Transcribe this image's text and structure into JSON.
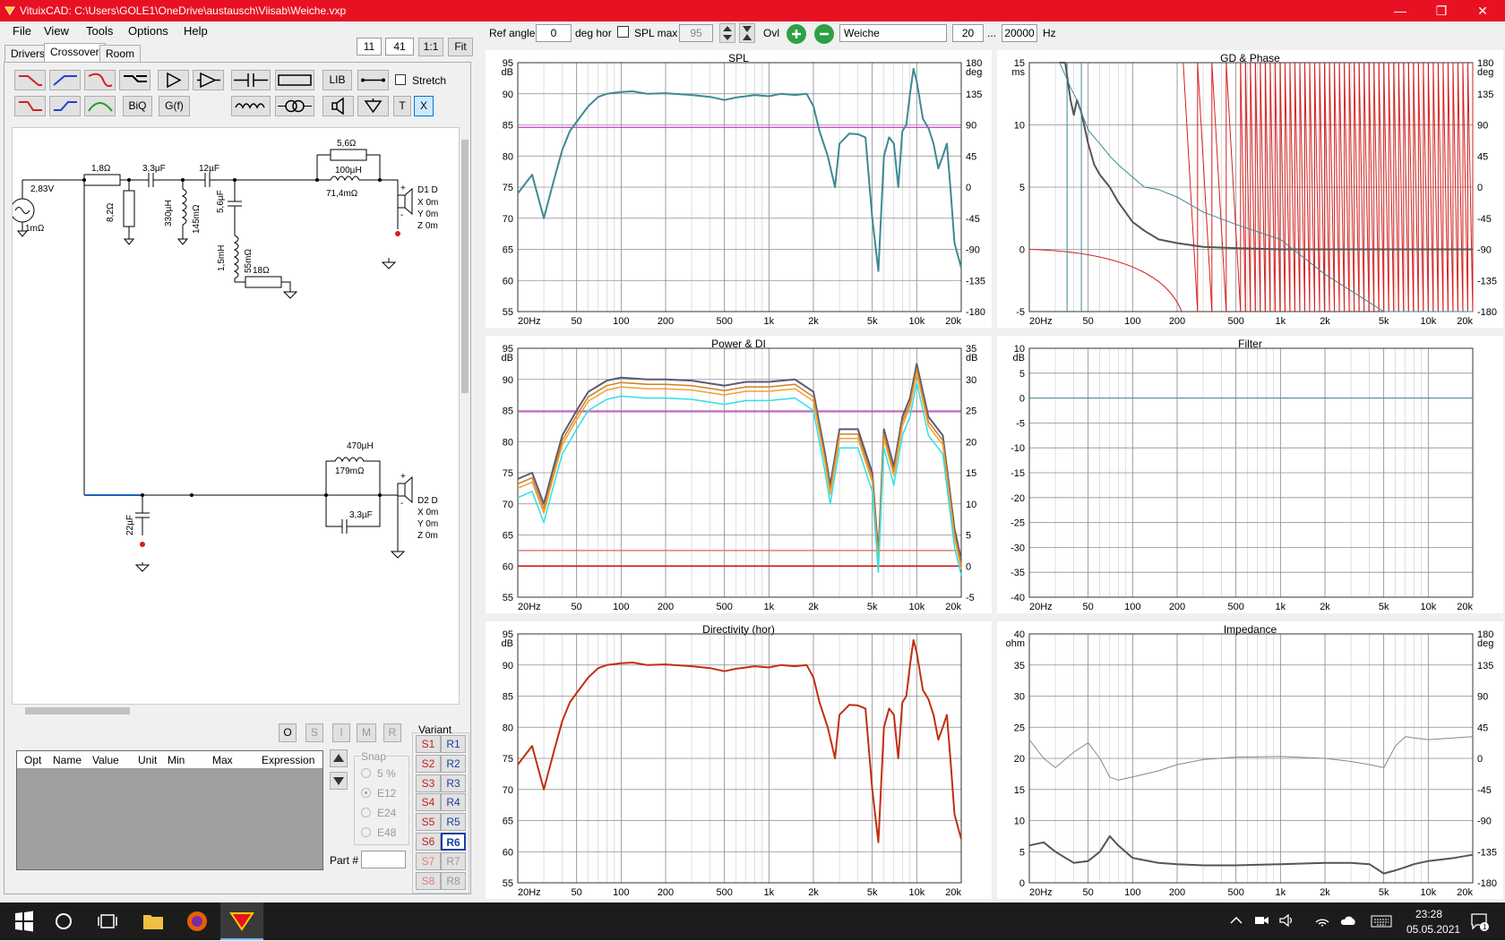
{
  "window": {
    "title": "VituixCAD: C:\\Users\\GOLE1\\OneDrive\\austausch\\Viisab\\Weiche.vxp",
    "minimize": "—",
    "maximize": "❐",
    "close": "✕"
  },
  "menu": [
    "File",
    "View",
    "Tools",
    "Options",
    "Help"
  ],
  "zoom": {
    "v1": "11",
    "v2": "41",
    "btn_11": "1:1",
    "btn_fit": "Fit"
  },
  "tabs": [
    "Drivers",
    "Crossover",
    "Room"
  ],
  "tools": {
    "lib": "LIB",
    "biq": "BiQ",
    "gf": "G(f)",
    "stretch": "Stretch",
    "t": "T",
    "x": "X"
  },
  "top": {
    "ref_angle_label": "Ref angle",
    "ref_angle": "0",
    "deg_hor": "deg hor",
    "spl_max_label": "SPL max",
    "spl_max": "95",
    "ovl_label": "Ovl",
    "name": "Weiche",
    "fmin": "20",
    "dots": "...",
    "fmax": "20000",
    "hz": "Hz"
  },
  "schematic": {
    "source": "2,83V",
    "source_r": "1mΩ",
    "r1": "1,8Ω",
    "r2": "8,2Ω",
    "c1": "3,3µF",
    "l1": "330µH",
    "l1r": "145mΩ",
    "c2": "12µF",
    "c3": "5,6µF",
    "l2": "1,5mH",
    "l2r": "55mΩ",
    "r3": "18Ω",
    "r4": "5,6Ω",
    "l3": "100µH",
    "l3r": "71,4mΩ",
    "d1": "D1 D",
    "d1x": "X 0m",
    "d1y": "Y 0m",
    "d1z": "Z 0m",
    "l4": "470µH",
    "l4r": "179mΩ",
    "c4": "3,3µF",
    "c5": "22µF",
    "d2": "D2 D",
    "d2x": "X 0m",
    "d2y": "Y 0m",
    "d2z": "Z 0m",
    "plus": "+",
    "minus": "-"
  },
  "osim": [
    "O",
    "S",
    "I",
    "M",
    "R"
  ],
  "table": {
    "headers": [
      "Opt",
      "Name",
      "Value",
      "Unit",
      "Min",
      "Max",
      "Expression"
    ]
  },
  "snap": {
    "label": "Snap",
    "options": [
      "5 %",
      "E12",
      "E24",
      "E48"
    ],
    "part_label": "Part #"
  },
  "variant": {
    "label": "Variant",
    "s": [
      "S1",
      "S2",
      "S3",
      "S4",
      "S5",
      "S6",
      "S7",
      "S8"
    ],
    "r": [
      "R1",
      "R2",
      "R3",
      "R4",
      "R5",
      "R6",
      "R7",
      "R8"
    ]
  },
  "colors": {
    "teal": "#3d8a94",
    "red": "#d42020",
    "magenta": "#cc33cc",
    "dir": "#c03010",
    "grid": "#c8c8c8",
    "gridMajor": "#8c8c8c"
  },
  "freq_ticks": [
    "20Hz",
    "50",
    "100",
    "200",
    "500",
    "1k",
    "2k",
    "5k",
    "10k",
    "20k"
  ],
  "chart_data": [
    {
      "type": "line",
      "title": "SPL",
      "ylabel": "dB",
      "y2label": "deg",
      "ylim": [
        55,
        95
      ],
      "y2lim": [
        -180,
        180
      ],
      "yticks": [
        "95",
        "90",
        "85",
        "80",
        "75",
        "70",
        "65",
        "60",
        "55"
      ],
      "y2ticks": [
        "180",
        "135",
        "90",
        "45",
        "0",
        "-45",
        "-90",
        "-135",
        "-180"
      ],
      "x": [
        20,
        25,
        30,
        35,
        40,
        45,
        50,
        60,
        70,
        80,
        100,
        120,
        150,
        200,
        300,
        400,
        500,
        600,
        700,
        800,
        1000,
        1200,
        1500,
        1800,
        2000,
        2200,
        2500,
        2800,
        3000,
        3500,
        4000,
        4500,
        5000,
        5500,
        6000,
        6500,
        7000,
        7500,
        8000,
        8500,
        9000,
        9500,
        10000,
        11000,
        12000,
        13000,
        14000,
        15000,
        16000,
        17000,
        18000,
        20000
      ],
      "series": [
        {
          "values": [
            74,
            77,
            70,
            76,
            81,
            84,
            85.5,
            88,
            89.5,
            90,
            90.3,
            90.4,
            90,
            90.1,
            89.8,
            89.5,
            89,
            89.4,
            89.6,
            89.8,
            89.6,
            90,
            89.8,
            90,
            88,
            84,
            80,
            75,
            82,
            83.6,
            83.5,
            83,
            70,
            61.5,
            80,
            83,
            82,
            75,
            84,
            85,
            90,
            94,
            92,
            86,
            84.5,
            82,
            78,
            80,
            82,
            74,
            66,
            62
          ]
        }
      ],
      "hline": 84.6
    },
    {
      "type": "line",
      "title": "GD & Phase",
      "ylabel": "ms",
      "y2label": "deg",
      "ylim": [
        -5,
        15
      ],
      "y2lim": [
        -180,
        180
      ],
      "yticks": [
        "15",
        "10",
        "5",
        "0",
        "-5"
      ],
      "y2ticks": [
        "180",
        "135",
        "90",
        "45",
        "0",
        "-45",
        "-90",
        "-135",
        "-180"
      ],
      "x": [
        32,
        35,
        38,
        40,
        42,
        45,
        50,
        55,
        60,
        70,
        80,
        100,
        120,
        150,
        200,
        300,
        500,
        1000,
        2000,
        5000,
        10000,
        20000
      ],
      "series": [
        {
          "values": [
            15,
            15,
            12,
            10.8,
            12,
            11,
            8.5,
            6.8,
            6,
            5,
            3.8,
            2.2,
            1.5,
            0.8,
            0.5,
            0.2,
            0.1,
            0,
            0,
            0,
            0,
            0
          ]
        },
        {
          "values": [
            15,
            14,
            13,
            12.5,
            12,
            11,
            9.6,
            9,
            8.5,
            7.5,
            6.8,
            5.8,
            5,
            4.8,
            4.2,
            3,
            2,
            0.8,
            -2,
            -5,
            -5,
            -5
          ]
        }
      ]
    },
    {
      "type": "line",
      "title": "Power & DI",
      "ylabel": "dB",
      "y2label": "dB",
      "ylim": [
        55,
        95
      ],
      "y2lim": [
        -5,
        35
      ],
      "yticks": [
        "95",
        "90",
        "85",
        "80",
        "75",
        "70",
        "65",
        "60",
        "55"
      ],
      "y2ticks": [
        "35",
        "30",
        "25",
        "20",
        "15",
        "10",
        "5",
        "0",
        "-5"
      ],
      "x": [
        20,
        25,
        30,
        35,
        40,
        50,
        60,
        80,
        100,
        150,
        200,
        300,
        500,
        700,
        1000,
        1500,
        2000,
        2400,
        2600,
        3000,
        4000,
        5000,
        5500,
        6000,
        7000,
        8000,
        9000,
        10000,
        12000,
        15000,
        18000,
        20000
      ],
      "series": [
        {
          "values": [
            74,
            75,
            70,
            76,
            81,
            85,
            88,
            89.8,
            90.3,
            90,
            90,
            89.8,
            89,
            89.6,
            89.6,
            90,
            88,
            78,
            73,
            82,
            82,
            75,
            62,
            82,
            76,
            84,
            87,
            92.5,
            84,
            81,
            66,
            61
          ]
        },
        {
          "values": [
            73.2,
            74.2,
            69.2,
            75.2,
            80.2,
            84.2,
            87.2,
            89,
            89.5,
            89.2,
            89.2,
            89,
            88.2,
            88.8,
            88.8,
            89.2,
            87.2,
            77.2,
            72.2,
            81.2,
            81.2,
            74.2,
            61.2,
            81.2,
            75.2,
            83.2,
            86.2,
            91.7,
            83.2,
            80.2,
            65.2,
            60.2
          ]
        },
        {
          "values": [
            72.5,
            73.5,
            68.5,
            74.5,
            79.5,
            83.5,
            86.5,
            88.3,
            88.8,
            88.5,
            88.5,
            88.3,
            87.5,
            88.1,
            88.1,
            88.5,
            86.5,
            76.5,
            71.5,
            80.5,
            80.5,
            73.5,
            60.5,
            80.5,
            74.5,
            82.5,
            85.5,
            91,
            82.5,
            79.5,
            64.5,
            59.5
          ]
        },
        {
          "values": [
            71,
            72,
            67,
            73,
            78,
            82,
            85,
            86.8,
            87.3,
            87,
            87,
            86.8,
            86,
            86.6,
            86.6,
            87,
            85,
            75,
            70,
            79,
            79,
            72,
            59,
            79,
            73,
            81,
            84,
            89.5,
            81,
            78,
            63,
            58.5
          ]
        }
      ],
      "hlines": [
        84.8,
        62.5,
        60
      ]
    },
    {
      "type": "line",
      "title": "Filter",
      "ylabel": "dB",
      "ylim": [
        -40,
        10
      ],
      "yticks": [
        "10",
        "5",
        "0",
        "-5",
        "-10",
        "-15",
        "-20",
        "-25",
        "-30",
        "-35",
        "-40"
      ],
      "x": [
        20,
        20000
      ],
      "series": [
        {
          "values": [
            0,
            0
          ]
        }
      ]
    },
    {
      "type": "line",
      "title": "Directivity (hor)",
      "ylabel": "dB",
      "ylim": [
        55,
        95
      ],
      "yticks": [
        "95",
        "90",
        "85",
        "80",
        "75",
        "70",
        "65",
        "60",
        "55"
      ],
      "x": [
        20,
        25,
        30,
        35,
        40,
        45,
        50,
        60,
        70,
        80,
        100,
        120,
        150,
        200,
        300,
        400,
        500,
        600,
        700,
        800,
        1000,
        1200,
        1500,
        1800,
        2000,
        2200,
        2500,
        2800,
        3000,
        3500,
        4000,
        4500,
        5000,
        5500,
        6000,
        6500,
        7000,
        7500,
        8000,
        8500,
        9000,
        9500,
        10000,
        11000,
        12000,
        13000,
        14000,
        15000,
        16000,
        17000,
        18000,
        20000
      ],
      "series": [
        {
          "values": [
            74,
            77,
            70,
            76,
            81,
            84,
            85.5,
            88,
            89.5,
            90,
            90.3,
            90.4,
            90,
            90.1,
            89.8,
            89.5,
            89,
            89.4,
            89.6,
            89.8,
            89.6,
            90,
            89.8,
            90,
            88,
            84,
            80,
            75,
            82,
            83.6,
            83.5,
            83,
            70,
            61.5,
            80,
            83,
            82,
            75,
            84,
            85,
            90,
            94,
            92,
            86,
            84.5,
            82,
            78,
            80,
            82,
            74,
            66,
            62
          ]
        }
      ]
    },
    {
      "type": "line",
      "title": "Impedance",
      "ylabel": "ohm",
      "y2label": "deg",
      "ylim": [
        0,
        40
      ],
      "y2lim": [
        -180,
        180
      ],
      "yticks": [
        "40",
        "35",
        "30",
        "25",
        "20",
        "15",
        "10",
        "5",
        "0"
      ],
      "y2ticks": [
        "180",
        "135",
        "90",
        "45",
        "0",
        "-45",
        "-90",
        "-135",
        "-180"
      ],
      "x": [
        20,
        25,
        30,
        40,
        50,
        60,
        70,
        80,
        100,
        150,
        200,
        300,
        500,
        1000,
        2000,
        3000,
        4000,
        5000,
        6000,
        7000,
        8000,
        10000,
        15000,
        20000
      ],
      "series": [
        {
          "values": [
            6,
            6.5,
            5,
            3.2,
            3.5,
            5,
            7.5,
            6,
            4,
            3.2,
            3,
            2.8,
            2.8,
            3,
            3.2,
            3.2,
            3,
            1.5,
            2,
            2.5,
            3,
            3.5,
            4,
            4.5
          ]
        },
        {
          "values": [
            23,
            20,
            18.5,
            21,
            22.5,
            20,
            17,
            16.5,
            17,
            18,
            19,
            19.8,
            20.2,
            20.3,
            20,
            19.5,
            19,
            18.5,
            22,
            23.5,
            23.3,
            23,
            23.3,
            23.5
          ]
        }
      ]
    }
  ]
}
